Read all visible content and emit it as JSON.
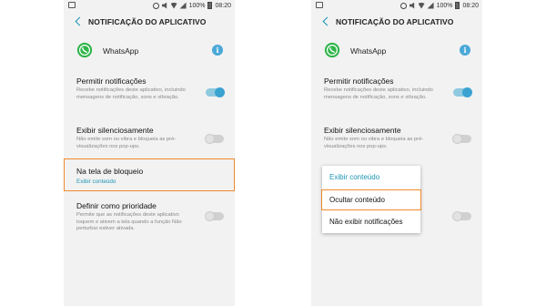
{
  "status_bar": {
    "time": "08:20",
    "battery": "100%"
  },
  "screen": {
    "title": "NOTIFICAÇÃO DO APLICATIVO",
    "app_name": "WhatsApp",
    "info_glyph": "i"
  },
  "settings": {
    "allow": {
      "title": "Permitir notificações",
      "desc": "Recebe notificações deste aplicativo, incluindo mensagens de notificação, sons e vibração.",
      "on": true
    },
    "silent": {
      "title": "Exibir silenciosamente",
      "desc": "Não emite som ou vibra e bloqueia as pré-visualizações nos pop-ups.",
      "on": false
    },
    "lock_screen": {
      "title": "Na tela de bloqueio",
      "value": "Exibir conteúdo"
    },
    "priority": {
      "title": "Definir como prioridade",
      "desc": "Permite que as notificações deste aplicativo toquem e ativem a tela quando a função Não perturbar estiver ativada.",
      "on": false
    }
  },
  "lock_screen_menu": {
    "options": [
      "Exibir conteúdo",
      "Ocultar conteúdo",
      "Não exibir notificações"
    ],
    "selected_index": 0,
    "highlighted_index": 1
  },
  "colors": {
    "accent": "#1b95b3",
    "highlight": "#f08a2c",
    "whatsapp": "#2fb54a"
  },
  "icons": {
    "back": "chevron-left-icon",
    "app": "whatsapp-icon",
    "info": "info-icon"
  }
}
